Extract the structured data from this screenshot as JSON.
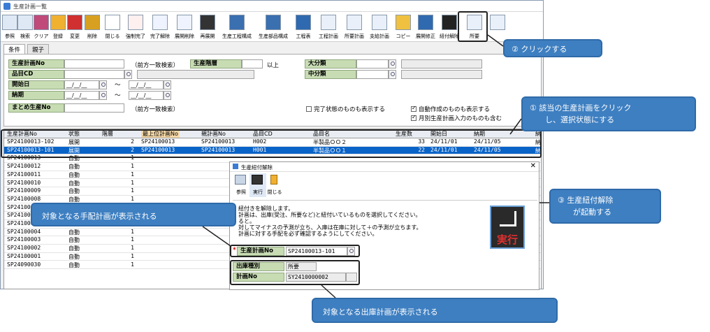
{
  "window": {
    "title": "生産計画一覧"
  },
  "toolbar": [
    {
      "label": "参照",
      "icon": "hand-pointer-icon"
    },
    {
      "label": "検索",
      "icon": "magnifier-icon"
    },
    {
      "label": "クリア",
      "icon": "eraser-icon"
    },
    {
      "label": "登録",
      "icon": "plus-icon"
    },
    {
      "label": "変更",
      "icon": "pencil-icon"
    },
    {
      "label": "削除",
      "icon": "minus-icon"
    },
    {
      "label": "閉じる",
      "icon": "glasses-icon"
    },
    {
      "label": "強制完了",
      "icon": "complete-stamp-icon"
    },
    {
      "label": "完了解除",
      "icon": "complete-undo-icon"
    },
    {
      "label": "展開削除",
      "icon": "document-delete-icon"
    },
    {
      "label": "再展開",
      "icon": "monitor-gear-icon"
    },
    {
      "label": "生産工程構成",
      "icon": "monitor-icon"
    },
    {
      "label": "生産部品構成",
      "icon": "monitor-icon"
    },
    {
      "label": "工程表",
      "icon": "window-icon"
    },
    {
      "label": "工程計画",
      "icon": "document-icon"
    },
    {
      "label": "所要計画",
      "icon": "document-icon"
    },
    {
      "label": "支給計画",
      "icon": "document-icon"
    },
    {
      "label": "コピー",
      "icon": "copy-icon"
    },
    {
      "label": "展開修正",
      "icon": "window-icon"
    },
    {
      "label": "紐付解除",
      "icon": "unlink-monitor-icon"
    },
    {
      "label": "所要",
      "icon": "document-icon"
    },
    {
      "label": "",
      "icon": "document-icon"
    }
  ],
  "tabs": [
    "条件",
    "親子"
  ],
  "conditions": {
    "plan_no_label": "生産計画No",
    "plan_no_hint": "（前方一致検索）",
    "level_label": "生産階層",
    "level_suffix": "以上",
    "item_cd_label": "品目CD",
    "start_label": "開始日",
    "due_label": "納期",
    "date_placeholder": "__/__/__",
    "tilde": "～",
    "summary_label": "まとめ生産No",
    "summary_hint": "（前方一致検索）",
    "major_label": "大分類",
    "middle_label": "中分類",
    "show_completed": "完了状態のものも表示する",
    "show_auto": "自動作成のものも表示する",
    "include_monthly": "月別生産計画入力のものも含む"
  },
  "grid": {
    "headers": [
      "生産計画No",
      "状態",
      "階層",
      "最上位計画No",
      "親計画No",
      "品目CD",
      "品目名",
      "生産数",
      "開始日",
      "納期",
      "納"
    ],
    "rows": [
      [
        "SP24100013-102",
        "展開",
        "2",
        "SP24100013",
        "SP24100013",
        "H002",
        "半製品ＯＯ２",
        "33",
        "24/11/01",
        "24/11/05",
        "納"
      ],
      [
        "SP24100013-101",
        "展開",
        "2",
        "SP24100013",
        "SP24100013",
        "H001",
        "半製品ＯＯ１",
        "22",
        "24/11/01",
        "24/11/05",
        "納"
      ],
      [
        "SP24100013",
        "自動",
        "1",
        "",
        "",
        "",
        "",
        "",
        "",
        "",
        ""
      ],
      [
        "SP24100012",
        "自動",
        "1",
        "",
        "",
        "",
        "",
        "",
        "",
        "",
        ""
      ],
      [
        "SP24100011",
        "自動",
        "1",
        "",
        "",
        "",
        "",
        "",
        "",
        "",
        ""
      ],
      [
        "SP24100010",
        "自動",
        "1",
        "",
        "",
        "",
        "",
        "",
        "",
        "",
        ""
      ],
      [
        "SP24100009",
        "自動",
        "1",
        "",
        "",
        "",
        "",
        "",
        "",
        "",
        ""
      ],
      [
        "SP24100008",
        "自動",
        "1",
        "",
        "",
        "",
        "",
        "",
        "",
        "",
        ""
      ],
      [
        "SP24100007",
        "自動",
        "1",
        "",
        "",
        "",
        "",
        "",
        "",
        "",
        ""
      ],
      [
        "SP24100006",
        "自動",
        "1",
        "",
        "",
        "",
        "",
        "",
        "",
        "",
        ""
      ],
      [
        "SP24100005",
        "自動",
        "1",
        "",
        "",
        "",
        "",
        "",
        "",
        "",
        ""
      ],
      [
        "SP24100004",
        "自動",
        "1",
        "",
        "",
        "",
        "",
        "",
        "",
        "",
        ""
      ],
      [
        "SP24100003",
        "自動",
        "1",
        "",
        "",
        "",
        "",
        "",
        "",
        "",
        ""
      ],
      [
        "SP24100002",
        "自動",
        "1",
        "",
        "",
        "",
        "",
        "",
        "",
        "",
        ""
      ],
      [
        "SP24100001",
        "自動",
        "1",
        "",
        "",
        "",
        "",
        "",
        "",
        "",
        ""
      ],
      [
        "SP24090030",
        "自動",
        "1",
        "",
        "",
        "",
        "",
        "",
        "",
        "",
        ""
      ]
    ]
  },
  "dialog": {
    "title": "生産紐付解除",
    "buttons": [
      "参照",
      "実行",
      "閉じる"
    ],
    "desc": [
      "紐付きを解除します。",
      "計画は、出庫(受注、所要など)と紐付いているものを選択してください。",
      "ると。",
      "対してマイナスの予測が立ち、入庫は在庫に対して＋の予測が立ちます。",
      "計画に対する手配を必ず確認するようにしてください。"
    ],
    "plan_no_label": "生産計画No",
    "plan_no_required": "*",
    "plan_no_value": "SP24100013-101",
    "issue_type_label": "出庫種別",
    "issue_type_value": "所要",
    "plan_label": "計画No",
    "plan_value": "SY2410000002",
    "execute_icon_text": "実行"
  },
  "callouts": {
    "c1": "①  該当の生産計画をクリック\n　　し、選択状態にする",
    "c2": "②  クリックする",
    "c3": "③  生産紐付解除\n　　が起動する",
    "c4": "対象となる手配計画が表示される",
    "c5": "対象となる出庫計画が表示される"
  },
  "colors": {
    "accent": "#3e7fc1",
    "selected_row": "#0a64c8",
    "label_bg": "#c8dcb4"
  }
}
